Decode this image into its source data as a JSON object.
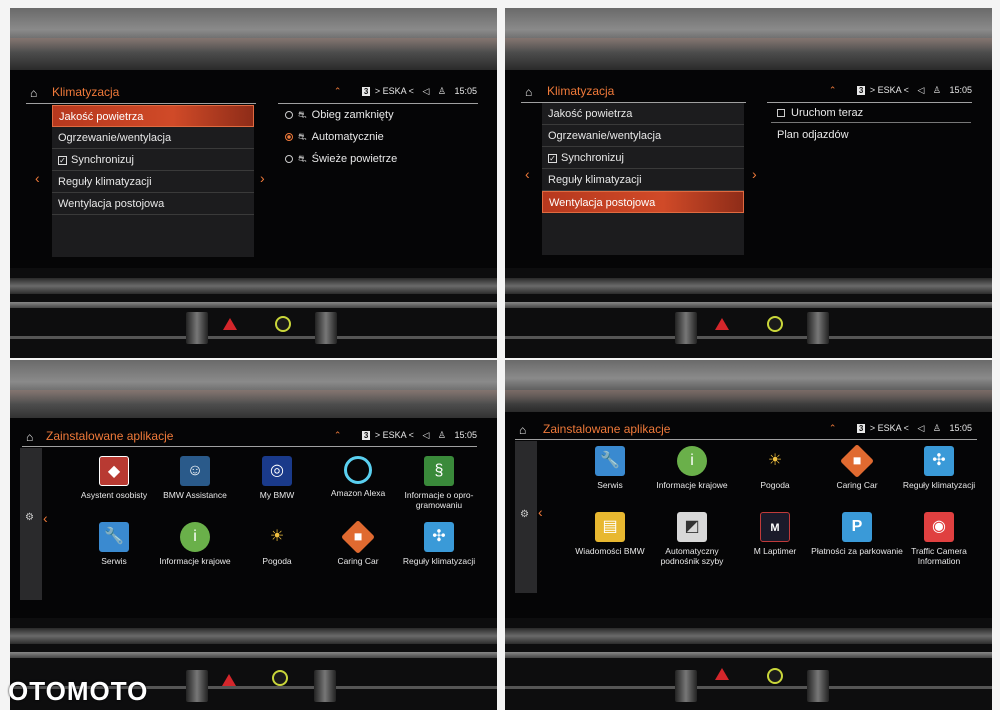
{
  "panel1": {
    "title": "Klimatyzacja",
    "status": {
      "preset": "3",
      "station": "> ESKA <",
      "time": "15:05"
    },
    "menu": [
      "Jakość powietrza",
      "Ogrzewanie/wentylacja",
      "Synchronizuj",
      "Reguły klimatyzacji",
      "Wentylacja postojowa"
    ],
    "options": [
      "Obieg zamknięty",
      "Automatycznie",
      "Świeże powietrze"
    ]
  },
  "panel2": {
    "title": "Klimatyzacja",
    "status": {
      "preset": "3",
      "station": "> ESKA <",
      "time": "15:05"
    },
    "menu": [
      "Jakość powietrza",
      "Ogrzewanie/wentylacja",
      "Synchronizuj",
      "Reguły klimatyzacji",
      "Wentylacja postojowa"
    ],
    "options": [
      "Uruchom teraz",
      "Plan odjazdów"
    ]
  },
  "panel3": {
    "title": "Zainstalowane aplikacje",
    "status": {
      "preset": "3",
      "station": "> ESKA <",
      "time": "15:05"
    },
    "apps": [
      "Asystent osobisty",
      "BMW Assistance",
      "My BMW",
      "Amazon Alexa",
      "Informacje o opro-gramowaniu",
      "Serwis",
      "Informacje krajowe",
      "Pogoda",
      "Caring Car",
      "Reguły klimatyzacji"
    ]
  },
  "panel4": {
    "title": "Zainstalowane aplikacje",
    "status": {
      "preset": "3",
      "station": "> ESKA <",
      "time": "15:05"
    },
    "apps": [
      "Serwis",
      "Informacje krajowe",
      "Pogoda",
      "Caring Car",
      "Reguły klimatyzacji",
      "Wiadomości BMW",
      "Automatyczny podnośnik szyby",
      "M Laptimer",
      "Płatności za parkowanie",
      "Traffic Camera Information"
    ]
  },
  "watermark": "OTOMOTO",
  "colors": {
    "accent": "#f07a3a",
    "selected": "#c4401f"
  }
}
